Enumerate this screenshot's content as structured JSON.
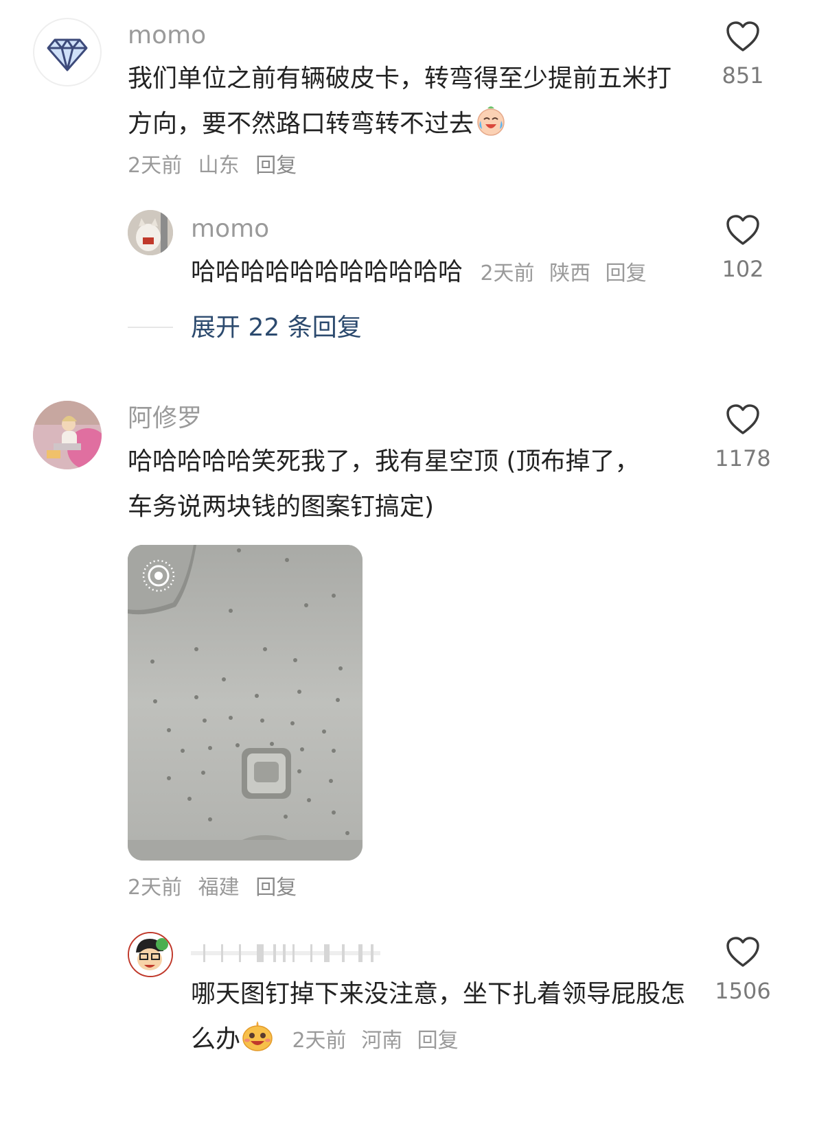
{
  "comments": [
    {
      "username": "momo",
      "text": "我们单位之前有辆破皮卡，转弯得至少提前五米打方向，要不然路口转弯转不过去",
      "time": "2天前",
      "location": "山东",
      "reply_label": "回复",
      "likes": "851",
      "avatar_icon": "diamond-icon",
      "emoji": "crying-laughing-emoji",
      "replies": [
        {
          "username": "momo",
          "text": "哈哈哈哈哈哈哈哈哈哈哈",
          "time": "2天前",
          "location": "陕西",
          "reply_label": "回复",
          "likes": "102",
          "avatar_icon": "cat-photo-avatar"
        }
      ],
      "expand_label": "展开 22 条回复"
    },
    {
      "username": "阿修罗",
      "text": "哈哈哈哈哈笑死我了，我有星空顶 (顶布掉了，车务说两块钱的图案钉搞定)",
      "time": "2天前",
      "location": "福建",
      "reply_label": "回复",
      "likes": "1178",
      "avatar_icon": "person-photo-avatar",
      "has_live_photo": true,
      "live_photo_icon": "live-photo-icon",
      "replies": [
        {
          "username": "",
          "text": "哪天图钉掉下来没注意，坐下扎着领导屁股怎么办",
          "time": "2天前",
          "location": "河南",
          "reply_label": "回复",
          "likes": "1506",
          "avatar_icon": "cartoon-avatar",
          "emoji": "grinning-emoji"
        }
      ]
    }
  ],
  "colors": {
    "meta_gray": "#9a9a9a",
    "expand_blue": "#2c4a6e",
    "heart_stroke": "#3a3a3a"
  }
}
